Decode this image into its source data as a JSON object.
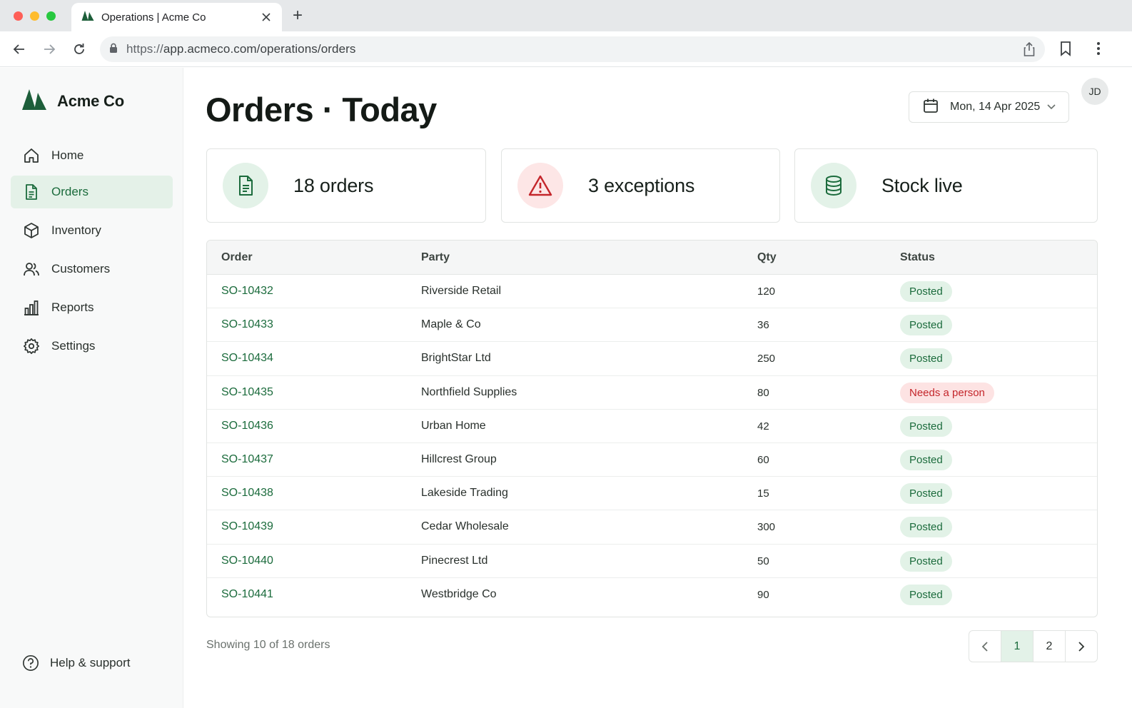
{
  "browser": {
    "tab_title": "Operations | Acme Co",
    "new_tab_label": "+",
    "url_secure": "https://",
    "url_path": "app.acmeco.com/operations/orders"
  },
  "sidebar": {
    "brand": "Acme Co",
    "items": [
      {
        "label": "Home",
        "icon": "home-icon",
        "active": false
      },
      {
        "label": "Orders",
        "icon": "document-icon",
        "active": true
      },
      {
        "label": "Inventory",
        "icon": "box-icon",
        "active": false
      },
      {
        "label": "Customers",
        "icon": "users-icon",
        "active": false
      },
      {
        "label": "Reports",
        "icon": "bar-chart-icon",
        "active": false
      },
      {
        "label": "Settings",
        "icon": "gear-icon",
        "active": false
      }
    ],
    "help_label": "Help & support"
  },
  "header": {
    "title": "Orders · Today",
    "date": "Mon, 14 Apr 2025",
    "avatar_initials": "JD"
  },
  "stats": [
    {
      "label": "18 orders",
      "icon": "document-icon",
      "tone": "green"
    },
    {
      "label": "3 exceptions",
      "icon": "warning-icon",
      "tone": "red"
    },
    {
      "label": "Stock live",
      "icon": "database-icon",
      "tone": "green"
    }
  ],
  "table": {
    "columns": [
      "Order",
      "Party",
      "Qty",
      "Status"
    ],
    "rows": [
      {
        "order": "SO-10432",
        "party": "Riverside Retail",
        "qty": "120",
        "status": "Posted",
        "tone": "ok"
      },
      {
        "order": "SO-10433",
        "party": "Maple & Co",
        "qty": "36",
        "status": "Posted",
        "tone": "ok"
      },
      {
        "order": "SO-10434",
        "party": "BrightStar Ltd",
        "qty": "250",
        "status": "Posted",
        "tone": "ok"
      },
      {
        "order": "SO-10435",
        "party": "Northfield Supplies",
        "qty": "80",
        "status": "Needs a person",
        "tone": "warn"
      },
      {
        "order": "SO-10436",
        "party": "Urban Home",
        "qty": "42",
        "status": "Posted",
        "tone": "ok"
      },
      {
        "order": "SO-10437",
        "party": "Hillcrest Group",
        "qty": "60",
        "status": "Posted",
        "tone": "ok"
      },
      {
        "order": "SO-10438",
        "party": "Lakeside Trading",
        "qty": "15",
        "status": "Posted",
        "tone": "ok"
      },
      {
        "order": "SO-10439",
        "party": "Cedar Wholesale",
        "qty": "300",
        "status": "Posted",
        "tone": "ok"
      },
      {
        "order": "SO-10440",
        "party": "Pinecrest Ltd",
        "qty": "50",
        "status": "Posted",
        "tone": "ok"
      },
      {
        "order": "SO-10441",
        "party": "Westbridge Co",
        "qty": "90",
        "status": "Posted",
        "tone": "ok"
      }
    ]
  },
  "footer": {
    "showing": "Showing 10 of 18 orders",
    "pages": [
      "1",
      "2"
    ],
    "current_page": "1"
  },
  "colors": {
    "accent": "#1b6b3c",
    "accent_bg": "#e3f2e8",
    "danger": "#c4262b",
    "danger_bg": "#fde3e3"
  }
}
